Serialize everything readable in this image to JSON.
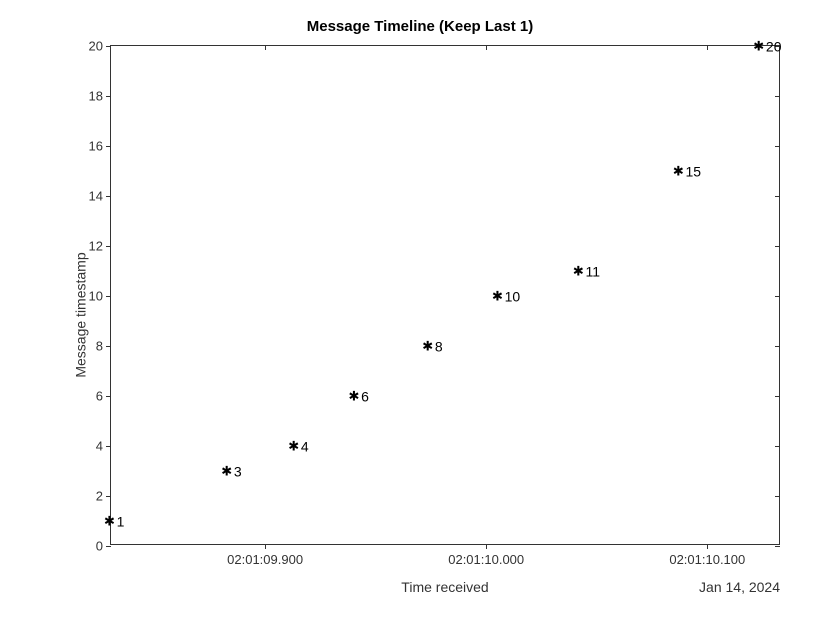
{
  "chart_data": {
    "type": "scatter",
    "title": "Message Timeline (Keep Last 1)",
    "xlabel": "Time received",
    "ylabel": "Message timestamp",
    "x_date_label": "Jan 14, 2024",
    "x_ticks_labels": [
      "02:01:09.900",
      "02:01:10.000",
      "02:01:10.100"
    ],
    "x_ticks_positions": [
      0.23,
      0.56,
      0.89
    ],
    "y_ticks": [
      0,
      2,
      4,
      6,
      8,
      10,
      12,
      14,
      16,
      18,
      20
    ],
    "ylim": [
      0,
      20
    ],
    "points": [
      {
        "x": 0.005,
        "y": 1,
        "label": "1"
      },
      {
        "x": 0.18,
        "y": 3,
        "label": "3"
      },
      {
        "x": 0.28,
        "y": 4,
        "label": "4"
      },
      {
        "x": 0.37,
        "y": 6,
        "label": "6"
      },
      {
        "x": 0.48,
        "y": 8,
        "label": "8"
      },
      {
        "x": 0.59,
        "y": 10,
        "label": "10"
      },
      {
        "x": 0.71,
        "y": 11,
        "label": "11"
      },
      {
        "x": 0.86,
        "y": 15,
        "label": "15"
      },
      {
        "x": 0.98,
        "y": 20,
        "label": "20"
      }
    ]
  }
}
